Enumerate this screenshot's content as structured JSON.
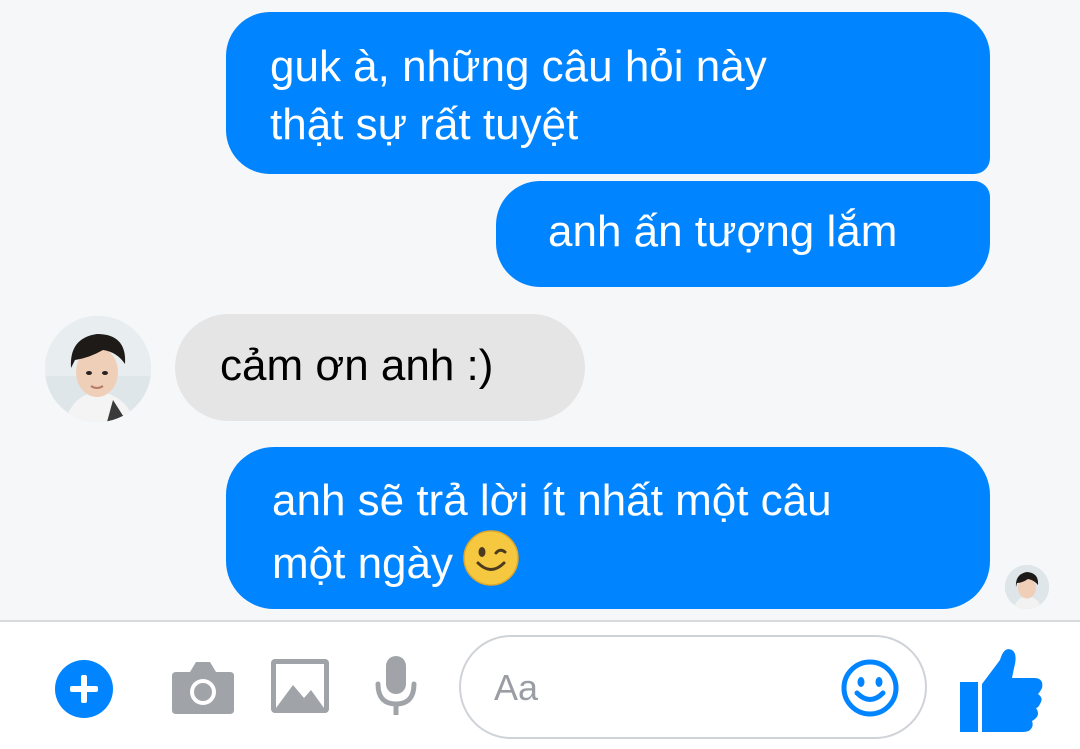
{
  "messages": [
    {
      "direction": "outgoing",
      "lines": [
        "guk à, những câu hỏi này",
        "thật sự rất tuyệt"
      ]
    },
    {
      "direction": "outgoing",
      "lines": [
        "anh ấn tượng lắm"
      ]
    },
    {
      "direction": "incoming",
      "lines": [
        "cảm ơn anh :)"
      ]
    },
    {
      "direction": "outgoing",
      "lines": [
        "anh sẽ trả lời ít nhất một câu",
        "một ngày"
      ],
      "trailing_emoji": "winking-face-emoji"
    }
  ],
  "composer": {
    "placeholder": "Aa",
    "icons": [
      "plus-icon",
      "camera-icon",
      "gallery-icon",
      "microphone-icon",
      "emoji-icon",
      "thumbs-up-icon"
    ]
  },
  "colors": {
    "accent": "#0084ff",
    "incoming_bubble": "#e5e5e5",
    "background": "#f6f7f9"
  }
}
